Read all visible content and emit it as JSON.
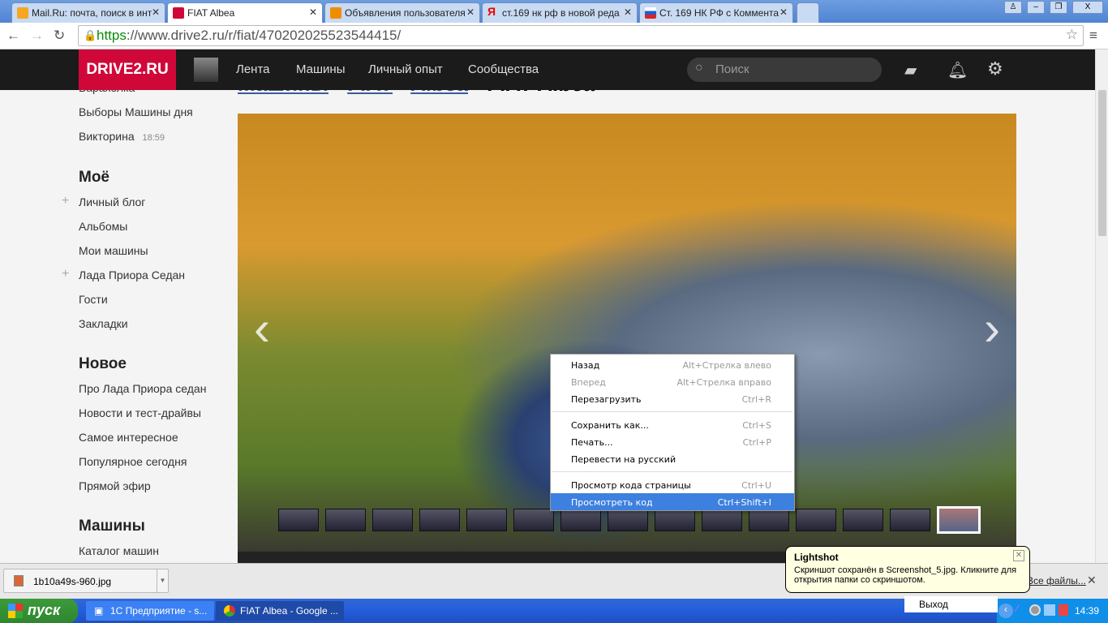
{
  "tabs": [
    {
      "label": "Mail.Ru: почта, поиск в инт",
      "color": "#f5a623"
    },
    {
      "label": "FIAT Albea",
      "color": "#d0083a"
    },
    {
      "label": "Объявления пользователя",
      "color": "#f08c00"
    },
    {
      "label": "ст.169 нк рф в новой реда",
      "color": "#ffffff"
    },
    {
      "label": "Ст. 169 НК РФ с Коммента",
      "color": "#1c5fd1"
    }
  ],
  "window_controls": {
    "minimize": "–",
    "restore": "❐",
    "close": "X",
    "user": "♙"
  },
  "address": {
    "scheme": "https",
    "rest": "://www.drive2.ru/r/fiat/470202025523544415/"
  },
  "site": {
    "logo": "DRIVE2.RU",
    "menu": [
      "Лента",
      "Машины",
      "Личный опыт",
      "Сообщества"
    ],
    "search_placeholder": "Поиск"
  },
  "breadcrumb": [
    "Машины",
    "FIAT",
    "Albea",
    "FIAT Albea"
  ],
  "sidebar": {
    "items": [
      {
        "label": "Барахолка"
      },
      {
        "label": "Выборы Машины дня"
      },
      {
        "label": "Викторина",
        "time": "18:59"
      }
    ],
    "sections": [
      {
        "title": "Моё",
        "items": [
          "Личный блог",
          "Альбомы",
          "Мои машины",
          "Лада Приора Седан",
          "Гости",
          "Закладки"
        ]
      },
      {
        "title": "Новое",
        "items": [
          "Про Лада Приора седан",
          "Новости и тест-драйвы",
          "Самое интересное",
          "Популярное сегодня",
          "Прямой эфир"
        ]
      },
      {
        "title": "Машины",
        "items": [
          "Каталог машин"
        ]
      }
    ]
  },
  "context_menu": [
    {
      "label": "Назад",
      "shortcut": "Alt+Стрелка влево"
    },
    {
      "label": "Вперед",
      "shortcut": "Alt+Стрелка вправо",
      "disabled": true
    },
    {
      "label": "Перезагрузить",
      "shortcut": "Ctrl+R"
    },
    {
      "label": "Сохранить как...",
      "shortcut": "Ctrl+S"
    },
    {
      "label": "Печать...",
      "shortcut": "Ctrl+P"
    },
    {
      "label": "Перевести на русский",
      "shortcut": ""
    },
    {
      "label": "Просмотр кода страницы",
      "shortcut": "Ctrl+U"
    },
    {
      "label": "Просмотреть код",
      "shortcut": "Ctrl+Shift+I",
      "highlighted": true
    }
  ],
  "download": {
    "file": "1b10a49s-960.jpg",
    "all_files": "Все файлы..."
  },
  "balloon": {
    "title": "Lightshot",
    "text": "Скриншот сохранён в Screenshot_5.jpg. Кликните для открытия папки со скриншотом."
  },
  "tray_menu": {
    "exit": "Выход"
  },
  "taskbar": {
    "start": "пуск",
    "items": [
      "1С Предприятие - s...",
      "FIAT Albea - Google ..."
    ],
    "clock": "14:39"
  }
}
